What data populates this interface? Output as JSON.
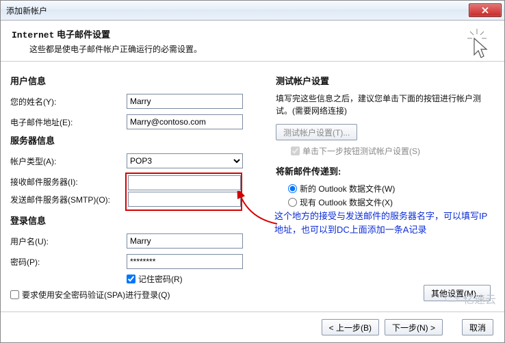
{
  "window": {
    "title": "添加新帐户"
  },
  "header": {
    "title_prefix": "Internet",
    "title_rest": " 电子邮件设置",
    "desc": "这些都是使电子邮件帐户正确运行的必需设置。"
  },
  "left": {
    "user_section": "用户信息",
    "name_label": "您的姓名(Y):",
    "name_value": "Marry",
    "email_label": "电子邮件地址(E):",
    "email_value": "Marry@contoso.com",
    "server_section": "服务器信息",
    "acct_type_label": "帐户类型(A):",
    "acct_type_value": "POP3",
    "incoming_label": "接收邮件服务器(I):",
    "incoming_value": "",
    "outgoing_label": "发送邮件服务器(SMTP)(O):",
    "outgoing_value": "",
    "login_section": "登录信息",
    "username_label": "用户名(U):",
    "username_value": "Marry",
    "password_label": "密码(P):",
    "password_value": "********",
    "remember_label": "记住密码(R)",
    "spa_label": "要求使用安全密码验证(SPA)进行登录(Q)"
  },
  "right": {
    "test_section": "测试帐户设置",
    "test_desc": "填写完这些信息之后，建议您单击下面的按钮进行帐户测试。(需要网络连接)",
    "test_btn": "测试帐户设置(T)...",
    "auto_test_label": "单击下一步按钮测试帐户设置(S)",
    "deliver_section": "将新邮件传递到:",
    "deliver_new": "新的 Outlook 数据文件(W)",
    "deliver_exist": "现有 Outlook 数据文件(X)",
    "more_btn": "其他设置(M)..."
  },
  "annotation": "这个地方的接受与发送邮件的服务器名字，可以填写IP地址，也可以到DC上面添加一条A记录",
  "footer": {
    "back": "< 上一步(B)",
    "next": "下一步(N) >",
    "cancel": "取消"
  },
  "watermark": "亿速云"
}
